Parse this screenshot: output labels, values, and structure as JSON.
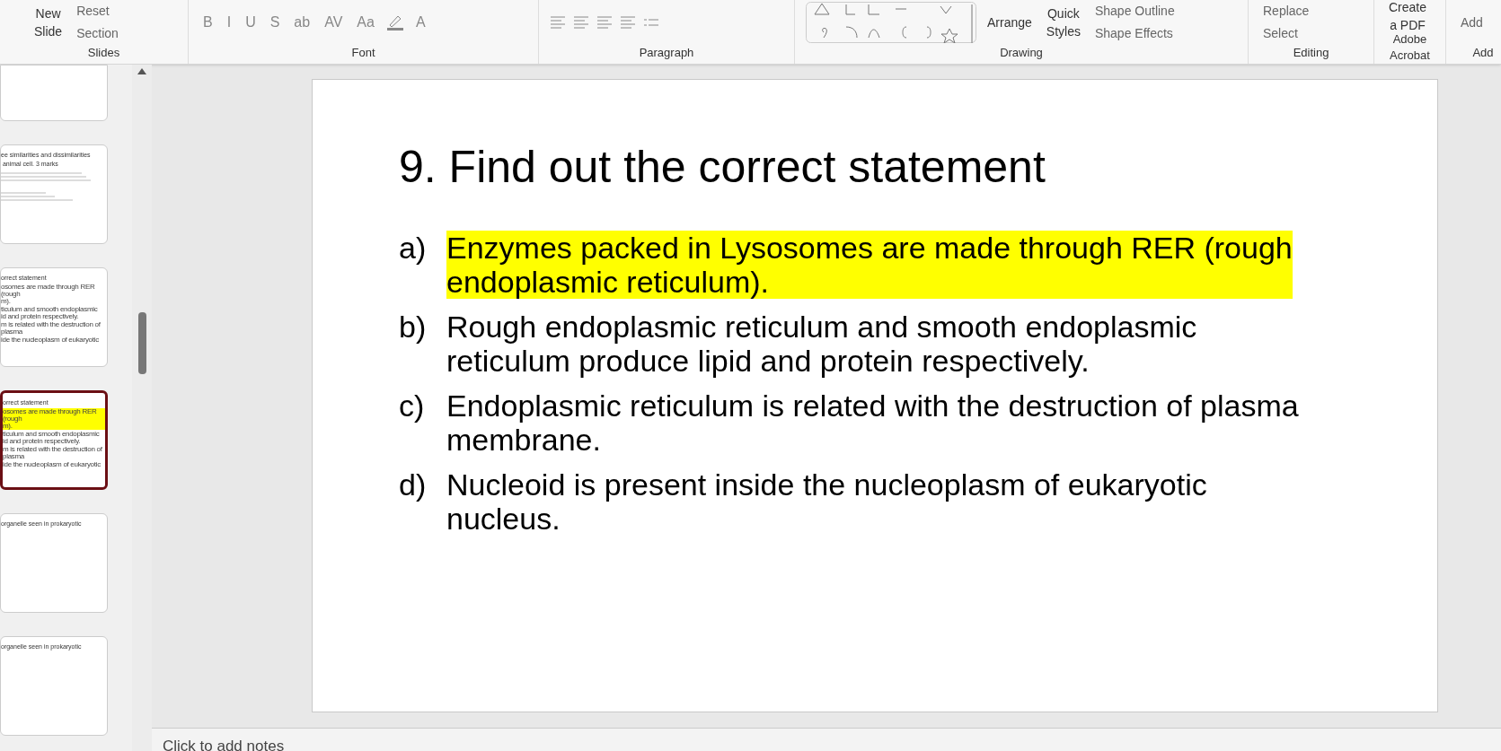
{
  "ribbon": {
    "groups": [
      {
        "label": "Slides",
        "controls": [
          {
            "kind": "stacked",
            "label": "New\nSlide"
          },
          {
            "kind": "small",
            "label": "Reset"
          },
          {
            "kind": "small",
            "label": "Section"
          }
        ]
      },
      {
        "label": "Font",
        "controls": [
          {
            "kind": "glyph",
            "label": "B"
          },
          {
            "kind": "glyph",
            "label": "I"
          },
          {
            "kind": "glyph",
            "label": "U"
          },
          {
            "kind": "glyph",
            "label": "S"
          },
          {
            "kind": "glyph",
            "label": "ab"
          },
          {
            "kind": "glyph",
            "label": "AV"
          },
          {
            "kind": "glyph",
            "label": "Aa"
          },
          {
            "kind": "highlight"
          },
          {
            "kind": "glyph",
            "label": "A"
          }
        ]
      },
      {
        "label": "Paragraph",
        "controls": [
          {
            "kind": "align"
          },
          {
            "kind": "align"
          },
          {
            "kind": "align"
          },
          {
            "kind": "align"
          },
          {
            "kind": "list"
          }
        ]
      },
      {
        "label": "Drawing",
        "controls": [
          {
            "kind": "shapes"
          },
          {
            "kind": "stacked",
            "label": "Arrange"
          },
          {
            "kind": "stacked",
            "label": "Quick\nStyles"
          },
          {
            "kind": "small",
            "label": "Shape Outline"
          },
          {
            "kind": "small",
            "label": "Shape Effects"
          }
        ]
      },
      {
        "label": "Editing",
        "controls": [
          {
            "kind": "small",
            "label": "Replace"
          },
          {
            "kind": "small",
            "label": "Select"
          }
        ]
      },
      {
        "label": "Adobe Acrobat",
        "controls": [
          {
            "kind": "stacked",
            "label": "Create\na PDF"
          }
        ]
      },
      {
        "label": "Add",
        "controls": [
          {
            "kind": "small",
            "label": "Add"
          }
        ]
      }
    ]
  },
  "thumbnails": [
    {
      "selected": false
    },
    {
      "selected": false,
      "title": "ee similarities and dissimilarities\n animal cell. 3 marks",
      "dense": true
    },
    {
      "selected": false,
      "title": "orrect statement",
      "lines": [
        {
          "text": "osomes are made through RER (rough\nm).",
          "highlighted": false
        },
        {
          "text": "ticulum and smooth endoplasmic\nid and protein respectively.",
          "highlighted": false
        },
        {
          "text": "m is related with the destruction of plasma",
          "highlighted": false
        },
        {
          "text": "ide the nucleoplasm of eukaryotic",
          "highlighted": false
        }
      ]
    },
    {
      "selected": true,
      "title": "orrect statement",
      "lines": [
        {
          "text": "osomes are made through RER (rough\nm).",
          "highlighted": true
        },
        {
          "text": "ticulum and smooth endoplasmic\nid and protein respectively.",
          "highlighted": false
        },
        {
          "text": "m is related with the destruction of plasma",
          "highlighted": false
        },
        {
          "text": "ide the nucleoplasm of eukaryotic",
          "highlighted": false
        }
      ]
    },
    {
      "selected": false,
      "title": "organelle seen in prokaryotic"
    },
    {
      "selected": false,
      "title": "organelle seen in prokaryotic"
    }
  ],
  "slide": {
    "title": "9. Find out the correct statement",
    "items": [
      {
        "marker": "a)",
        "text": "Enzymes packed in Lysosomes are made through RER (rough\nendoplasmic reticulum).",
        "highlighted": true
      },
      {
        "marker": "b)",
        "text": "Rough endoplasmic reticulum and smooth endoplasmic\nreticulum produce lipid and protein respectively.",
        "highlighted": false
      },
      {
        "marker": "c)",
        "text": "Endoplasmic reticulum is related with the destruction of plasma\nmembrane.",
        "highlighted": false
      },
      {
        "marker": "d)",
        "text": "Nucleoid is present inside the nucleoplasm of eukaryotic\nnucleus.",
        "highlighted": false
      }
    ]
  },
  "notes": {
    "placeholder": "Click to add notes"
  }
}
